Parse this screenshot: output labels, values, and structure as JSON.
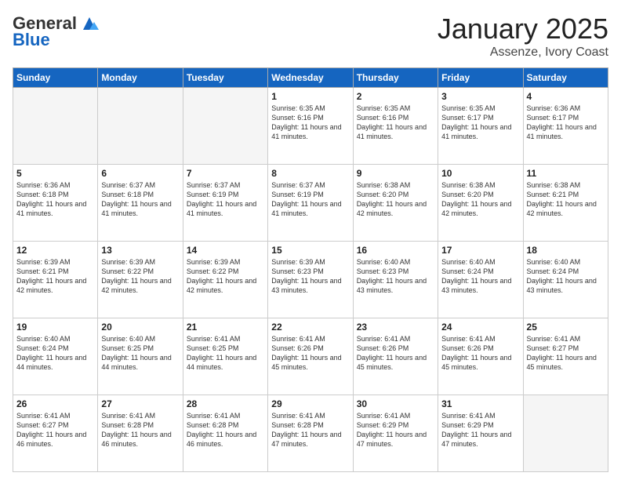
{
  "header": {
    "logo_general": "General",
    "logo_blue": "Blue",
    "month": "January 2025",
    "location": "Assenze, Ivory Coast"
  },
  "days_of_week": [
    "Sunday",
    "Monday",
    "Tuesday",
    "Wednesday",
    "Thursday",
    "Friday",
    "Saturday"
  ],
  "weeks": [
    [
      {
        "day": "",
        "sunrise": "",
        "sunset": "",
        "daylight": "",
        "empty": true
      },
      {
        "day": "",
        "sunrise": "",
        "sunset": "",
        "daylight": "",
        "empty": true
      },
      {
        "day": "",
        "sunrise": "",
        "sunset": "",
        "daylight": "",
        "empty": true
      },
      {
        "day": "1",
        "sunrise": "Sunrise: 6:35 AM",
        "sunset": "Sunset: 6:16 PM",
        "daylight": "Daylight: 11 hours and 41 minutes."
      },
      {
        "day": "2",
        "sunrise": "Sunrise: 6:35 AM",
        "sunset": "Sunset: 6:16 PM",
        "daylight": "Daylight: 11 hours and 41 minutes."
      },
      {
        "day": "3",
        "sunrise": "Sunrise: 6:35 AM",
        "sunset": "Sunset: 6:17 PM",
        "daylight": "Daylight: 11 hours and 41 minutes."
      },
      {
        "day": "4",
        "sunrise": "Sunrise: 6:36 AM",
        "sunset": "Sunset: 6:17 PM",
        "daylight": "Daylight: 11 hours and 41 minutes."
      }
    ],
    [
      {
        "day": "5",
        "sunrise": "Sunrise: 6:36 AM",
        "sunset": "Sunset: 6:18 PM",
        "daylight": "Daylight: 11 hours and 41 minutes."
      },
      {
        "day": "6",
        "sunrise": "Sunrise: 6:37 AM",
        "sunset": "Sunset: 6:18 PM",
        "daylight": "Daylight: 11 hours and 41 minutes."
      },
      {
        "day": "7",
        "sunrise": "Sunrise: 6:37 AM",
        "sunset": "Sunset: 6:19 PM",
        "daylight": "Daylight: 11 hours and 41 minutes."
      },
      {
        "day": "8",
        "sunrise": "Sunrise: 6:37 AM",
        "sunset": "Sunset: 6:19 PM",
        "daylight": "Daylight: 11 hours and 41 minutes."
      },
      {
        "day": "9",
        "sunrise": "Sunrise: 6:38 AM",
        "sunset": "Sunset: 6:20 PM",
        "daylight": "Daylight: 11 hours and 42 minutes."
      },
      {
        "day": "10",
        "sunrise": "Sunrise: 6:38 AM",
        "sunset": "Sunset: 6:20 PM",
        "daylight": "Daylight: 11 hours and 42 minutes."
      },
      {
        "day": "11",
        "sunrise": "Sunrise: 6:38 AM",
        "sunset": "Sunset: 6:21 PM",
        "daylight": "Daylight: 11 hours and 42 minutes."
      }
    ],
    [
      {
        "day": "12",
        "sunrise": "Sunrise: 6:39 AM",
        "sunset": "Sunset: 6:21 PM",
        "daylight": "Daylight: 11 hours and 42 minutes."
      },
      {
        "day": "13",
        "sunrise": "Sunrise: 6:39 AM",
        "sunset": "Sunset: 6:22 PM",
        "daylight": "Daylight: 11 hours and 42 minutes."
      },
      {
        "day": "14",
        "sunrise": "Sunrise: 6:39 AM",
        "sunset": "Sunset: 6:22 PM",
        "daylight": "Daylight: 11 hours and 42 minutes."
      },
      {
        "day": "15",
        "sunrise": "Sunrise: 6:39 AM",
        "sunset": "Sunset: 6:23 PM",
        "daylight": "Daylight: 11 hours and 43 minutes."
      },
      {
        "day": "16",
        "sunrise": "Sunrise: 6:40 AM",
        "sunset": "Sunset: 6:23 PM",
        "daylight": "Daylight: 11 hours and 43 minutes."
      },
      {
        "day": "17",
        "sunrise": "Sunrise: 6:40 AM",
        "sunset": "Sunset: 6:24 PM",
        "daylight": "Daylight: 11 hours and 43 minutes."
      },
      {
        "day": "18",
        "sunrise": "Sunrise: 6:40 AM",
        "sunset": "Sunset: 6:24 PM",
        "daylight": "Daylight: 11 hours and 43 minutes."
      }
    ],
    [
      {
        "day": "19",
        "sunrise": "Sunrise: 6:40 AM",
        "sunset": "Sunset: 6:24 PM",
        "daylight": "Daylight: 11 hours and 44 minutes."
      },
      {
        "day": "20",
        "sunrise": "Sunrise: 6:40 AM",
        "sunset": "Sunset: 6:25 PM",
        "daylight": "Daylight: 11 hours and 44 minutes."
      },
      {
        "day": "21",
        "sunrise": "Sunrise: 6:41 AM",
        "sunset": "Sunset: 6:25 PM",
        "daylight": "Daylight: 11 hours and 44 minutes."
      },
      {
        "day": "22",
        "sunrise": "Sunrise: 6:41 AM",
        "sunset": "Sunset: 6:26 PM",
        "daylight": "Daylight: 11 hours and 45 minutes."
      },
      {
        "day": "23",
        "sunrise": "Sunrise: 6:41 AM",
        "sunset": "Sunset: 6:26 PM",
        "daylight": "Daylight: 11 hours and 45 minutes."
      },
      {
        "day": "24",
        "sunrise": "Sunrise: 6:41 AM",
        "sunset": "Sunset: 6:26 PM",
        "daylight": "Daylight: 11 hours and 45 minutes."
      },
      {
        "day": "25",
        "sunrise": "Sunrise: 6:41 AM",
        "sunset": "Sunset: 6:27 PM",
        "daylight": "Daylight: 11 hours and 45 minutes."
      }
    ],
    [
      {
        "day": "26",
        "sunrise": "Sunrise: 6:41 AM",
        "sunset": "Sunset: 6:27 PM",
        "daylight": "Daylight: 11 hours and 46 minutes."
      },
      {
        "day": "27",
        "sunrise": "Sunrise: 6:41 AM",
        "sunset": "Sunset: 6:28 PM",
        "daylight": "Daylight: 11 hours and 46 minutes."
      },
      {
        "day": "28",
        "sunrise": "Sunrise: 6:41 AM",
        "sunset": "Sunset: 6:28 PM",
        "daylight": "Daylight: 11 hours and 46 minutes."
      },
      {
        "day": "29",
        "sunrise": "Sunrise: 6:41 AM",
        "sunset": "Sunset: 6:28 PM",
        "daylight": "Daylight: 11 hours and 47 minutes."
      },
      {
        "day": "30",
        "sunrise": "Sunrise: 6:41 AM",
        "sunset": "Sunset: 6:29 PM",
        "daylight": "Daylight: 11 hours and 47 minutes."
      },
      {
        "day": "31",
        "sunrise": "Sunrise: 6:41 AM",
        "sunset": "Sunset: 6:29 PM",
        "daylight": "Daylight: 11 hours and 47 minutes."
      },
      {
        "day": "",
        "sunrise": "",
        "sunset": "",
        "daylight": "",
        "empty": true
      }
    ]
  ]
}
